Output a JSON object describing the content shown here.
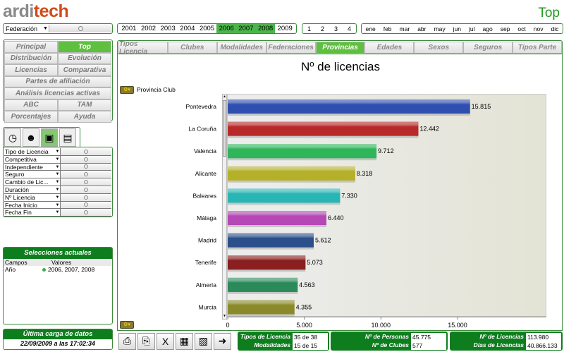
{
  "logo": {
    "arti": "ardi",
    "tech": "tech"
  },
  "page_heading": "Top",
  "federation_select": {
    "value": "Federación"
  },
  "years": [
    {
      "label": "2001",
      "selected": false
    },
    {
      "label": "2002",
      "selected": false
    },
    {
      "label": "2003",
      "selected": false
    },
    {
      "label": "2004",
      "selected": false
    },
    {
      "label": "2005",
      "selected": false
    },
    {
      "label": "2006",
      "selected": true
    },
    {
      "label": "2007",
      "selected": true
    },
    {
      "label": "2008",
      "selected": true
    },
    {
      "label": "2009",
      "selected": false
    }
  ],
  "quarters": [
    "1",
    "2",
    "3",
    "4"
  ],
  "months": [
    "ene",
    "feb",
    "mar",
    "abr",
    "may",
    "jun",
    "jul",
    "ago",
    "sep",
    "oct",
    "nov",
    "dic"
  ],
  "nav": [
    {
      "label": "Principal",
      "selected": false,
      "wide": false
    },
    {
      "label": "Top",
      "selected": true,
      "wide": false
    },
    {
      "label": "Distribución",
      "selected": false,
      "wide": false
    },
    {
      "label": "Evolución",
      "selected": false,
      "wide": false
    },
    {
      "label": "Licencias",
      "selected": false,
      "wide": false
    },
    {
      "label": "Comparativa",
      "selected": false,
      "wide": false
    },
    {
      "label": "Partes de afiliación",
      "selected": false,
      "wide": true
    },
    {
      "label": "Análisis licencias activas",
      "selected": false,
      "wide": true
    },
    {
      "label": "ABC",
      "selected": false,
      "wide": false
    },
    {
      "label": "TAM",
      "selected": false,
      "wide": false
    },
    {
      "label": "Porcentajes",
      "selected": false,
      "wide": false
    },
    {
      "label": "Ayuda",
      "selected": false,
      "wide": false
    }
  ],
  "tool_tabs": [
    {
      "icon": "clock-icon",
      "selected": false
    },
    {
      "icon": "person-icon",
      "selected": false
    },
    {
      "icon": "box-icon",
      "selected": true
    },
    {
      "icon": "document-icon",
      "selected": false
    }
  ],
  "filters": [
    "Tipo de Licencia",
    "Competitiva",
    "Independiente",
    "Seguro",
    "Cambio de Lic...",
    "Duración",
    "Nº Licencia",
    "Fecha Inicio",
    "Fecha Fin"
  ],
  "selections": {
    "title": "Selecciones actuales",
    "col_field": "Campos",
    "col_values": "Valores",
    "rows": [
      {
        "field": "Año",
        "values": "2006, 2007, 2008"
      }
    ]
  },
  "last_load": {
    "title": "Última carga de datos",
    "value": "22/09/2009 a las 17:02:34"
  },
  "main_tabs": [
    {
      "label": "Tipos Licencia",
      "selected": false
    },
    {
      "label": "Clubes",
      "selected": false
    },
    {
      "label": "Modalidades",
      "selected": false
    },
    {
      "label": "Federaciones",
      "selected": false
    },
    {
      "label": "Provincias",
      "selected": true
    },
    {
      "label": "Edades",
      "selected": false
    },
    {
      "label": "Sexos",
      "selected": false
    },
    {
      "label": "Seguros",
      "selected": false
    },
    {
      "label": "Tipos Parte",
      "selected": false
    }
  ],
  "chart_field_label": "Provincia Club",
  "chart_data": {
    "type": "bar",
    "orientation": "horizontal",
    "title": "Nº de licencias",
    "categories": [
      "Pontevedra",
      "La Coruña",
      "Valencia",
      "Alicante",
      "Baleares",
      "Málaga",
      "Madrid",
      "Tenerife",
      "Almería",
      "Murcia"
    ],
    "values": [
      15815,
      12442,
      9712,
      8318,
      7330,
      6440,
      5612,
      5073,
      4563,
      4355
    ],
    "value_labels": [
      "15.815",
      "12.442",
      "9.712",
      "8.318",
      "7.330",
      "6.440",
      "5.612",
      "5.073",
      "4.563",
      "4.355"
    ],
    "colors": [
      "#2f4fb0",
      "#b82a2a",
      "#2fb55a",
      "#b5b02a",
      "#2ab5b5",
      "#b548b5",
      "#2a4f8a",
      "#8a1f1f",
      "#2a8a5a",
      "#8a8a2a"
    ],
    "xticks": [
      0,
      5000,
      10000,
      15000
    ],
    "xtick_labels": [
      "0",
      "5.000",
      "10.000",
      "15.000"
    ],
    "xlim": [
      0,
      20800
    ]
  },
  "toolbar": [
    {
      "icon": "printer-icon"
    },
    {
      "icon": "print-preview-icon"
    },
    {
      "icon": "excel-icon"
    },
    {
      "icon": "table-icon"
    },
    {
      "icon": "image-icon"
    },
    {
      "icon": "forward-arrow-icon"
    }
  ],
  "stats": [
    [
      {
        "label": "Tipos de Licencia",
        "value": "35 de 38"
      },
      {
        "label": "Modalidades",
        "value": "15 de 15"
      }
    ],
    [
      {
        "label": "Nº de Personas",
        "value": "45.775"
      },
      {
        "label": "Nº de Clubes",
        "value": "577"
      }
    ],
    [
      {
        "label": "Nº de Licencias",
        "value": "113.980"
      },
      {
        "label": "Días de Licencias",
        "value": "40.866.133"
      }
    ]
  ]
}
